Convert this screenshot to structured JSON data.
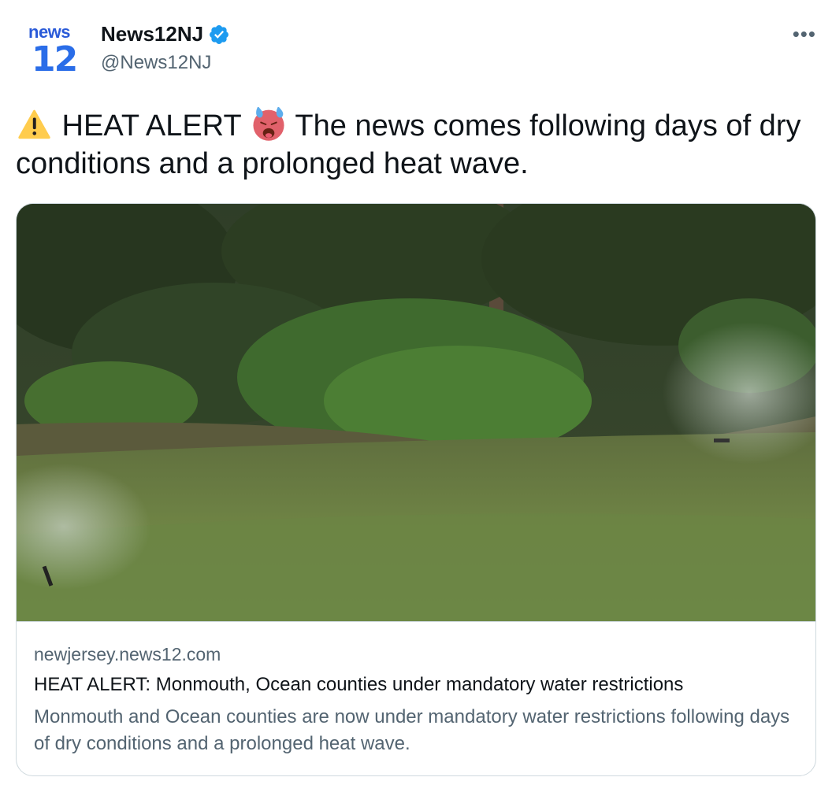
{
  "account": {
    "avatar_top": "news",
    "avatar_bottom": "12",
    "display_name": "News12NJ",
    "handle": "@News12NJ",
    "verified_icon": "verified-badge-icon",
    "more_label": "•••"
  },
  "tweet": {
    "segments": [
      {
        "type": "emoji",
        "name": "warning-icon"
      },
      {
        "type": "text",
        "text": " HEAT ALERT "
      },
      {
        "type": "emoji",
        "name": "hot-face-icon"
      },
      {
        "type": "text",
        "text": " The news comes following days of dry conditions and a prolonged heat wave."
      }
    ],
    "part1": " HEAT ALERT ",
    "part2": " The news comes following days of dry conditions and a prolonged heat wave."
  },
  "card": {
    "image_alt": "Lawn sprinklers watering grass in front of trees and shrubs",
    "domain": "newjersey.news12.com",
    "title": "HEAT ALERT: Monmouth, Ocean counties under mandatory water restrictions",
    "description": "Monmouth and Ocean counties are now under mandatory water restrictions following days of dry conditions and a prolonged heat wave."
  },
  "colors": {
    "text": "#0f1419",
    "secondary": "#536471",
    "verified": "#1d9bf0",
    "border": "#cfd9de",
    "brand": "#2a6de8"
  }
}
